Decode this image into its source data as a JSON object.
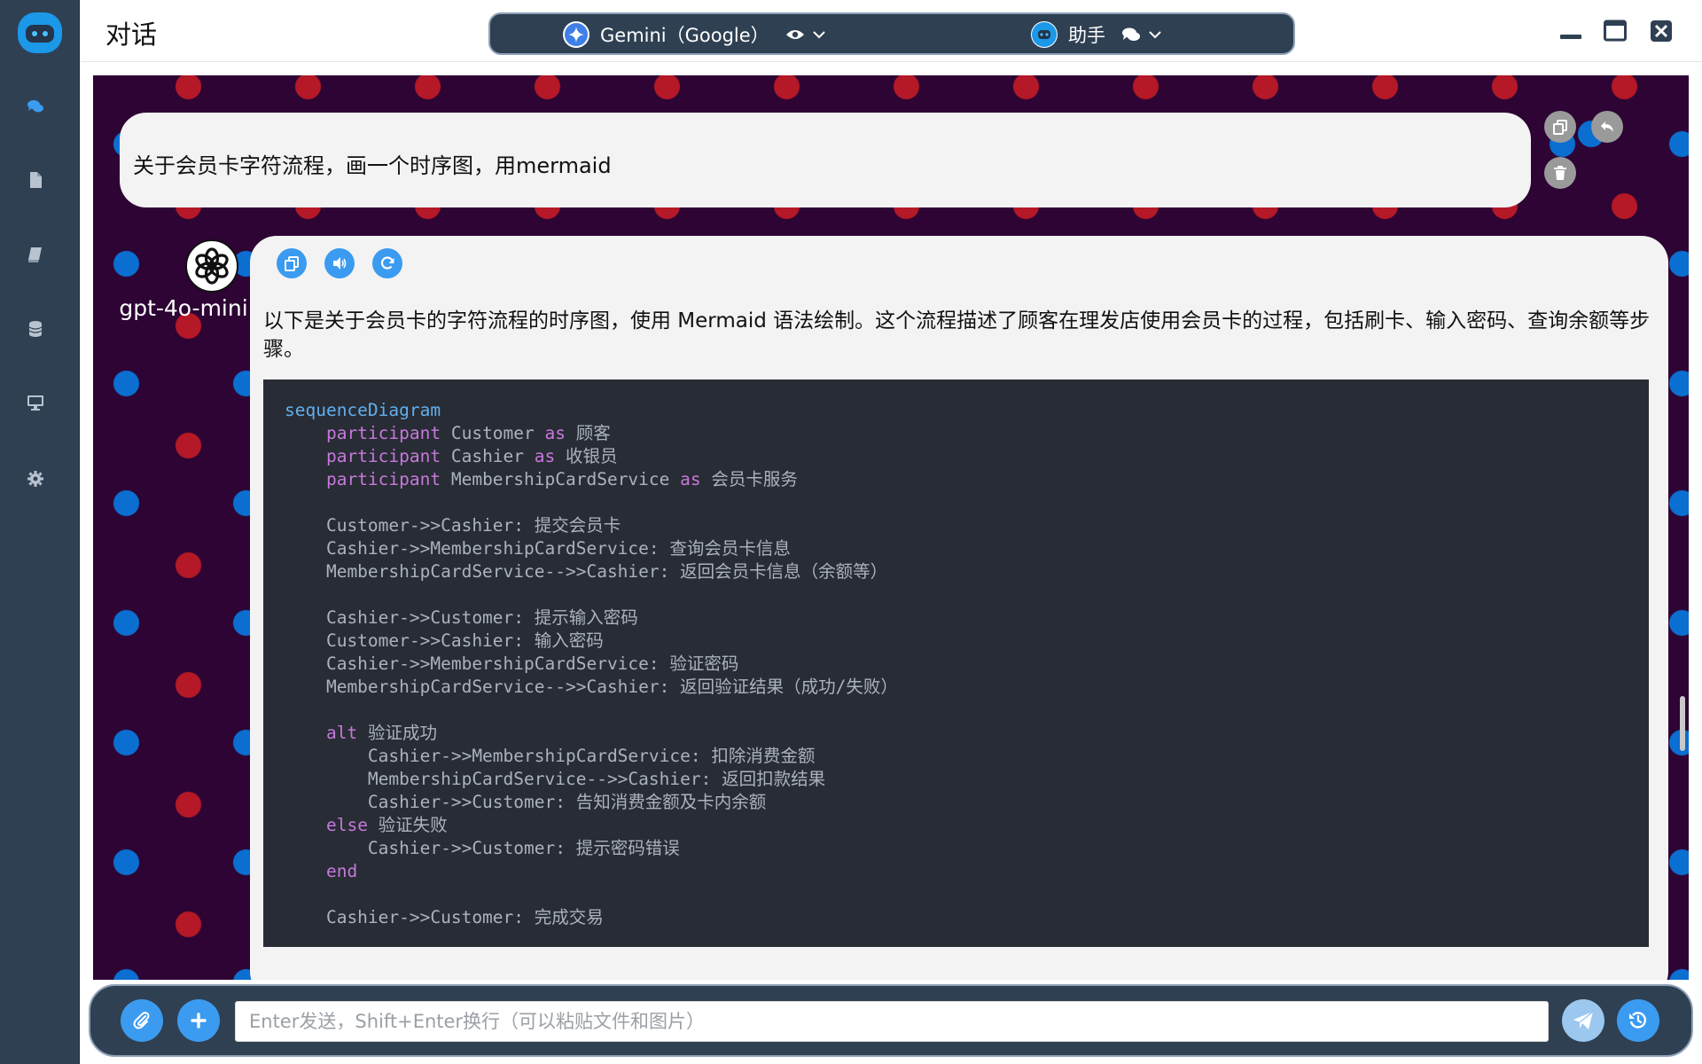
{
  "header": {
    "title": "对话"
  },
  "model_bar": {
    "model": {
      "label": "Gemini（Google）",
      "icon": "gemini-sparkle-icon",
      "view_icon": "eye-icon"
    },
    "assistant": {
      "label": "助手",
      "icon": "robot-icon",
      "chat_icon": "comments-icon"
    }
  },
  "sidebar": {
    "items": [
      {
        "name": "chat",
        "icon": "comments-icon"
      },
      {
        "name": "documents",
        "icon": "file-icon"
      },
      {
        "name": "knowledge",
        "icon": "book-icon"
      },
      {
        "name": "database",
        "icon": "database-icon"
      },
      {
        "name": "desktop",
        "icon": "desktop-icon"
      },
      {
        "name": "settings",
        "icon": "gear-icon"
      }
    ]
  },
  "messages": {
    "user": {
      "text": "关于会员卡字符流程，画一个时序图，用mermaid"
    },
    "assistant": {
      "model_name": "gpt-4o-mini",
      "intro": "以下是关于会员卡的字符流程的时序图，使用 Mermaid 语法绘制。这个流程描述了顾客在理发店使用会员卡的过程，包括刷卡、输入密码、查询余额等步骤。",
      "code_lines": [
        "sequenceDiagram",
        "    participant Customer as 顾客",
        "    participant Cashier as 收银员",
        "    participant MembershipCardService as 会员卡服务",
        "",
        "    Customer->>Cashier: 提交会员卡",
        "    Cashier->>MembershipCardService: 查询会员卡信息",
        "    MembershipCardService-->>Cashier: 返回会员卡信息（余额等）",
        "",
        "    Cashier->>Customer: 提示输入密码",
        "    Customer->>Cashier: 输入密码",
        "    Cashier->>MembershipCardService: 验证密码",
        "    MembershipCardService-->>Cashier: 返回验证结果（成功/失败）",
        "",
        "    alt 验证成功",
        "        Cashier->>MembershipCardService: 扣除消费金额",
        "        MembershipCardService-->>Cashier: 返回扣款结果",
        "        Cashier->>Customer: 告知消费金额及卡内余额",
        "    else 验证失败",
        "        Cashier->>Customer: 提示密码错误",
        "    end",
        "",
        "    Cashier->>Customer: 完成交易"
      ]
    }
  },
  "input": {
    "placeholder": "Enter发送，Shift+Enter换行（可以粘贴文件和图片）",
    "value": ""
  },
  "colors": {
    "sidebar": "#2f4053",
    "accent": "#3b9bf0",
    "chat_background": "#2d0434",
    "dot_red": "#b51826",
    "dot_blue": "#0b6ed1",
    "code_background": "#282c34"
  }
}
